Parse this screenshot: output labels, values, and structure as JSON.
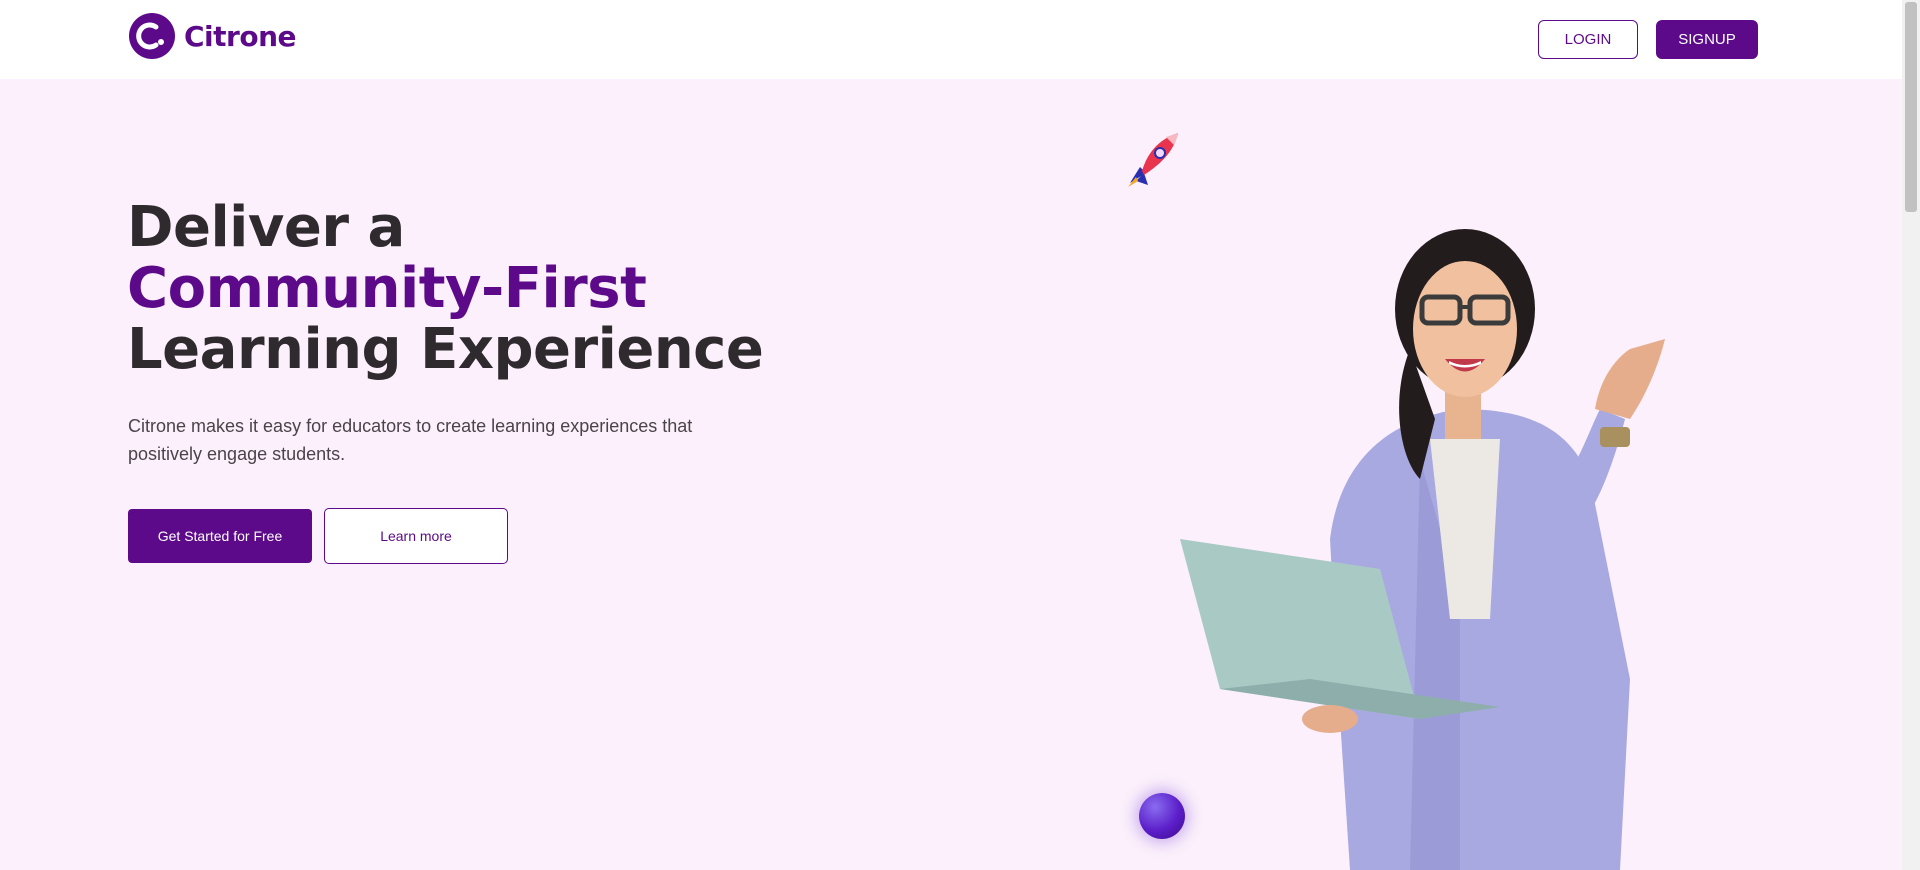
{
  "brand": {
    "name": "Citrone",
    "logo_icon": "citrone-c-logo-icon",
    "color": "#5c0a8a"
  },
  "nav": {
    "login_label": "LOGIN",
    "signup_label": "SIGNUP"
  },
  "hero": {
    "headline_line1": "Deliver a",
    "headline_accent": "Community-First",
    "headline_line3": "Learning Experience",
    "subtext": "Citrone makes it easy for educators to create learning experiences that positively engage students.",
    "primary_cta": "Get Started for Free",
    "secondary_cta": "Learn more",
    "background": "#fbf0fb",
    "decorations": [
      "rocket-icon",
      "purple-orb",
      "woman-with-laptop-photo"
    ]
  }
}
